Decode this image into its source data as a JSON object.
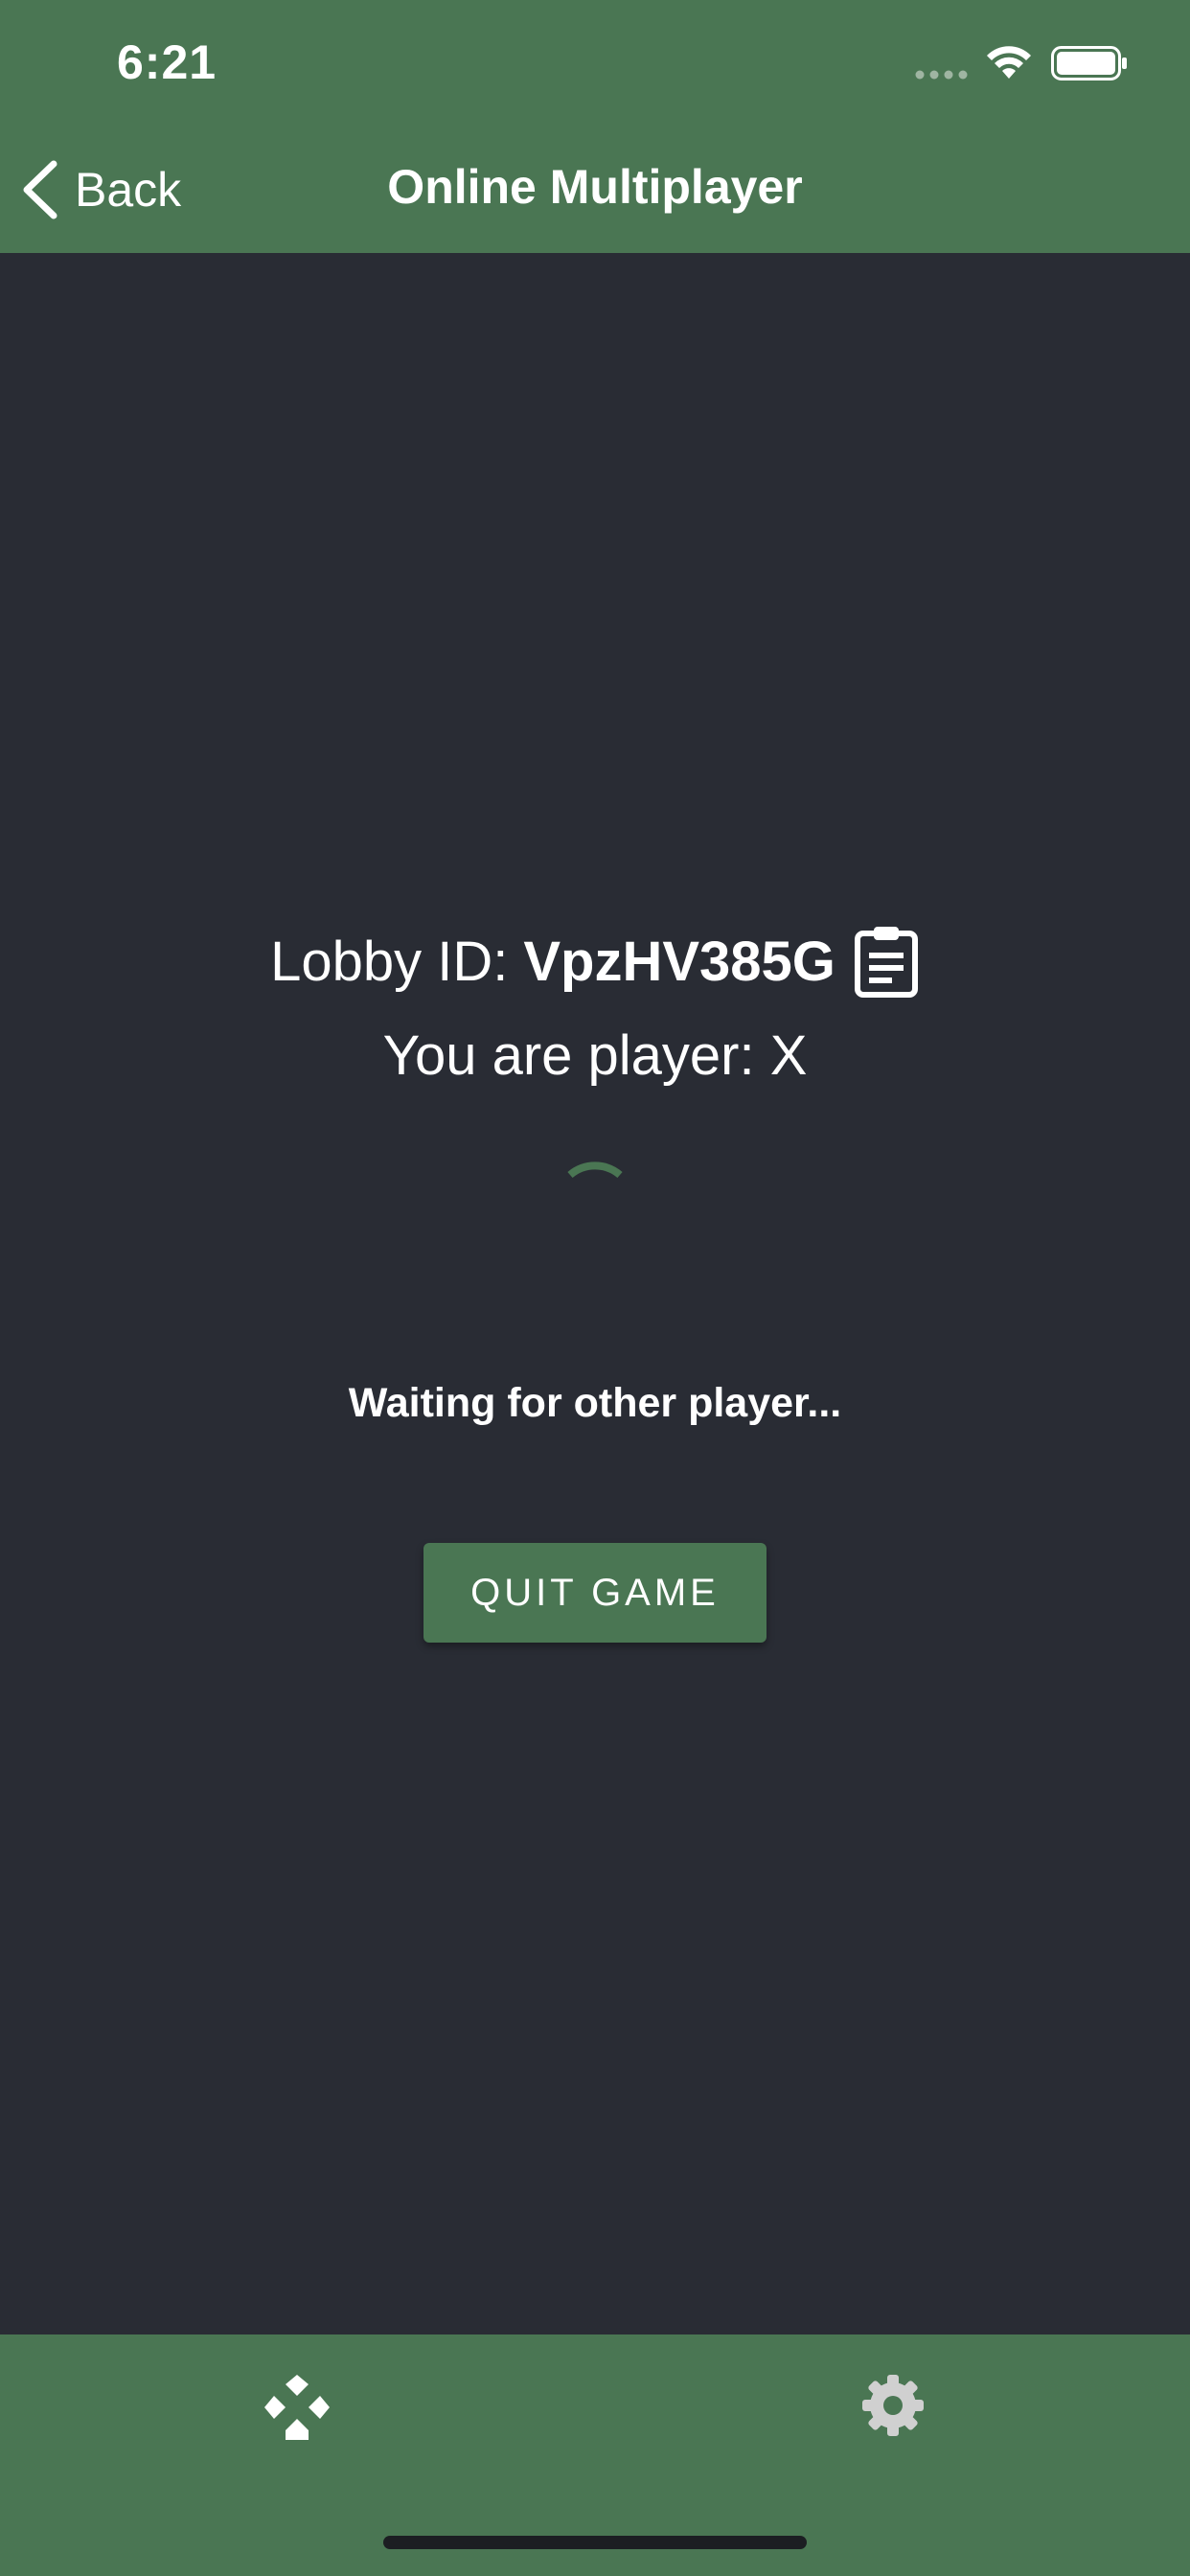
{
  "status_bar": {
    "time": "6:21"
  },
  "nav": {
    "back_label": "Back",
    "title": "Online Multiplayer"
  },
  "lobby": {
    "label": "Lobby ID:",
    "id": "VpzHV385G",
    "player_line": "You are player: X",
    "waiting_text": "Waiting for other player...",
    "quit_label": "QUIT GAME"
  },
  "tabs": [
    {
      "icon": "gamepad-icon",
      "active": true
    },
    {
      "icon": "gear-icon",
      "active": false
    }
  ],
  "colors": {
    "accent": "#4a7653",
    "background": "#292c34",
    "text": "#ffffff",
    "tab_active": "#ffffff",
    "tab_inactive": "#d0d0d0"
  }
}
